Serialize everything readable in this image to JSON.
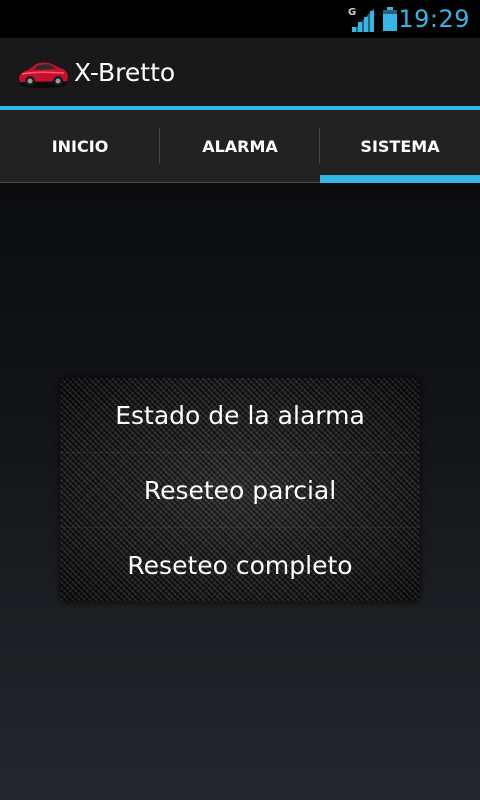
{
  "status_bar": {
    "time": "19:29",
    "network_type": "G",
    "signal_icon": "signal-icon",
    "battery_icon": "battery-icon"
  },
  "action_bar": {
    "app_icon": "car-icon",
    "title": "X-Bretto"
  },
  "tabs": [
    {
      "label": "INICIO",
      "selected": false
    },
    {
      "label": "ALARMA",
      "selected": false
    },
    {
      "label": "SISTEMA",
      "selected": true
    }
  ],
  "menu": {
    "items": [
      {
        "label": "Estado de la alarma"
      },
      {
        "label": "Reseteo parcial"
      },
      {
        "label": "Reseteo completo"
      }
    ]
  },
  "colors": {
    "accent": "#33b5e5",
    "action_bar_bg": "#191919",
    "tab_bar_bg": "#222222",
    "text": "#ffffff"
  }
}
